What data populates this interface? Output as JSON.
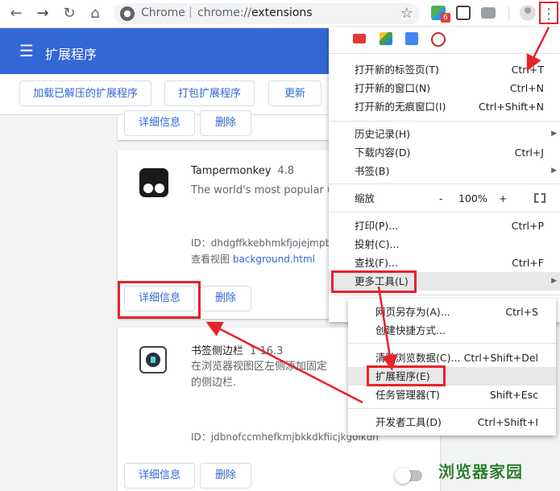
{
  "browser": {
    "omnibox_site": "Chrome",
    "omnibox_separator": "|",
    "omnibox_scheme": "chrome://",
    "omnibox_host": "extensions",
    "extension_badge": "6"
  },
  "extensions_page": {
    "title": "扩展程序",
    "toolbar": {
      "load_unpacked": "加载已解压的扩展程序",
      "pack": "打包扩展程序",
      "update": "更新"
    },
    "details_label": "详细信息",
    "remove_label": "删除",
    "items": [
      {
        "name": "Tampermonkey",
        "version": "4.8",
        "description": "The world's most popular use",
        "id_label": "ID：dhdgffkkebhmkfjojejmpb",
        "views_label": "查看视图",
        "views_link": "background.html"
      },
      {
        "name": "书签侧边栏",
        "version": "1 16.3",
        "description_line1": "在浏览器视图区左侧添加固定",
        "description_line2": "的侧边栏.",
        "id_label": "ID：jdbnofccmhefkmjbkkdkfiicjkgoikdn"
      }
    ]
  },
  "chrome_menu": {
    "items": [
      {
        "label": "打开新的标签页(T)",
        "shortcut": "Ctrl+T"
      },
      {
        "label": "打开新的窗口(N)",
        "shortcut": "Ctrl+N"
      },
      {
        "label": "打开新的无痕窗口(I)",
        "shortcut": "Ctrl+Shift+N"
      },
      {
        "label": "历史记录(H)"
      },
      {
        "label": "下载内容(D)",
        "shortcut": "Ctrl+J"
      },
      {
        "label": "书签(B)"
      },
      {
        "label": "缩放",
        "zoom_minus": "-",
        "zoom_value": "100%",
        "zoom_plus": "+"
      },
      {
        "label": "打印(P)...",
        "shortcut": "Ctrl+P"
      },
      {
        "label": "投射(C)..."
      },
      {
        "label": "查找(F)...",
        "shortcut": "Ctrl+F"
      },
      {
        "label": "更多工具(L)"
      }
    ]
  },
  "more_tools_menu": {
    "items": [
      {
        "label": "网页另存为(A)...",
        "shortcut": "Ctrl+S"
      },
      {
        "label": "创建快捷方式..."
      },
      {
        "label": "清除浏览数据(C)...",
        "shortcut": "Ctrl+Shift+Del"
      },
      {
        "label": "扩展程序(E)"
      },
      {
        "label": "任务管理器(T)",
        "shortcut": "Shift+Esc"
      },
      {
        "label": "开发者工具(D)",
        "shortcut": "Ctrl+Shift+I"
      }
    ]
  },
  "watermark": "浏览器家园",
  "colors": {
    "header_blue": "#3367d6",
    "annotation_red": "#e8212a",
    "watermark_green": "#2e7d32"
  }
}
